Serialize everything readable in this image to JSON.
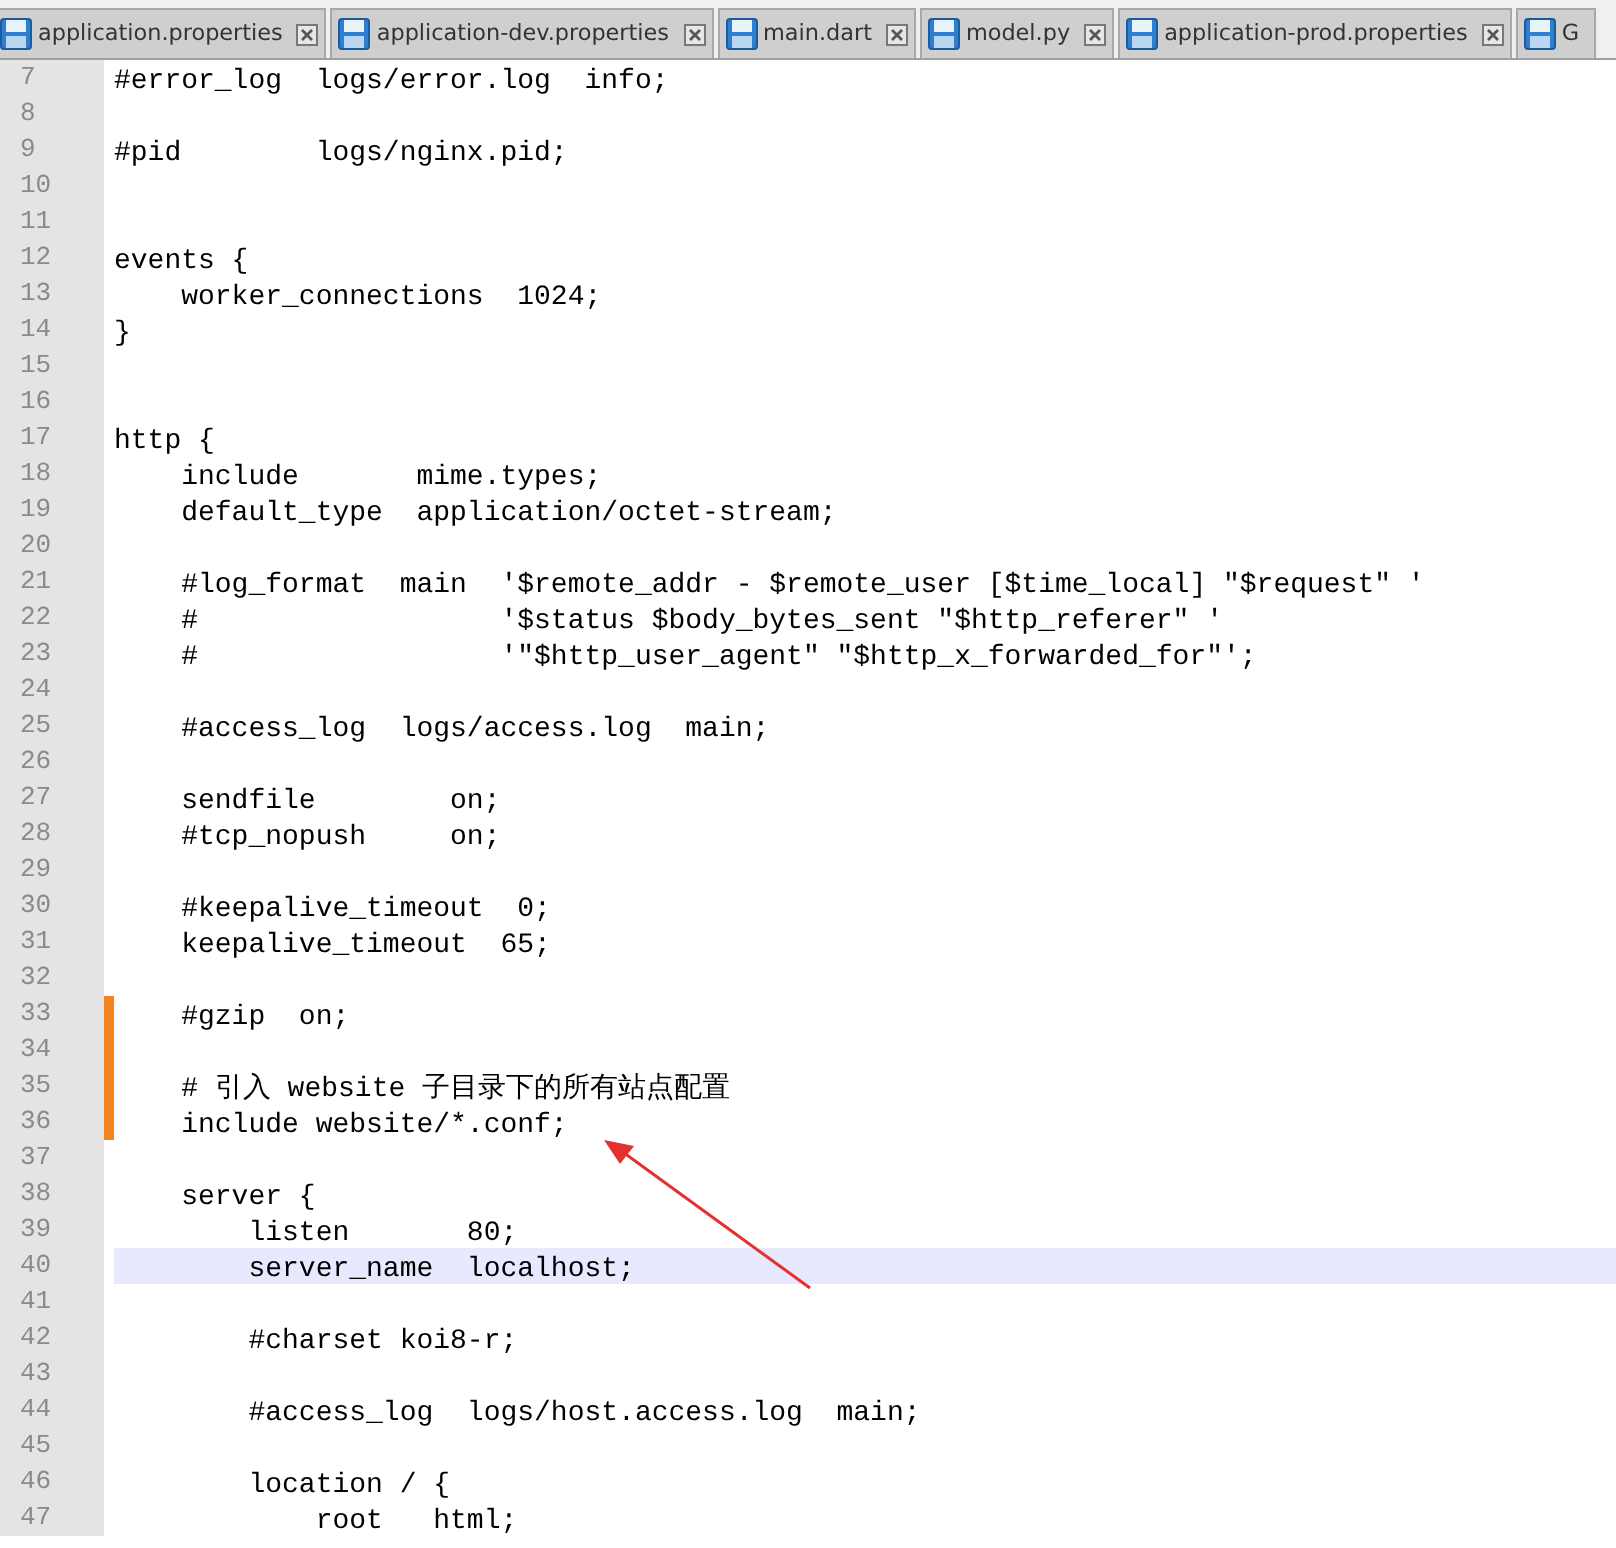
{
  "tabs": [
    {
      "label": "application.properties",
      "selected": false
    },
    {
      "label": "application-dev.properties",
      "selected": false
    },
    {
      "label": "main.dart",
      "selected": false
    },
    {
      "label": "model.py",
      "selected": false
    },
    {
      "label": "application-prod.properties",
      "selected": false
    },
    {
      "label": "G",
      "selected": false
    }
  ],
  "lines": [
    {
      "number": "7",
      "text": "#error_log  logs/error.log  info;",
      "modified": false,
      "current": false
    },
    {
      "number": "8",
      "modified": false,
      "current": false
    },
    {
      "number": "9",
      "text": "#pid        logs/nginx.pid;",
      "modified": false,
      "current": false
    },
    {
      "number": "10",
      "modified": false,
      "current": false
    },
    {
      "number": "11",
      "modified": false,
      "current": false
    },
    {
      "number": "12",
      "text": "events {",
      "modified": false,
      "current": false
    },
    {
      "number": "13",
      "text": "    worker_connections  1024;",
      "modified": false,
      "current": false
    },
    {
      "number": "14",
      "text": "}",
      "modified": false,
      "current": false
    },
    {
      "number": "15",
      "modified": false,
      "current": false
    },
    {
      "number": "16",
      "modified": false,
      "current": false
    },
    {
      "number": "17",
      "text": "http {",
      "modified": false,
      "current": false
    },
    {
      "number": "18",
      "text": "    include       mime.types;",
      "modified": false,
      "current": false
    },
    {
      "number": "19",
      "text": "    default_type  application/octet-stream;",
      "modified": false,
      "current": false
    },
    {
      "number": "20",
      "modified": false,
      "current": false
    },
    {
      "number": "21",
      "text": "    #log_format  main  '$remote_addr - $remote_user [$time_local] \"$request\" '",
      "modified": false,
      "current": false
    },
    {
      "number": "22",
      "text": "    #                  '$status $body_bytes_sent \"$http_referer\" '",
      "modified": false,
      "current": false
    },
    {
      "number": "23",
      "text": "    #                  '\"$http_user_agent\" \"$http_x_forwarded_for\"';",
      "modified": false,
      "current": false
    },
    {
      "number": "24",
      "modified": false,
      "current": false
    },
    {
      "number": "25",
      "text": "    #access_log  logs/access.log  main;",
      "modified": false,
      "current": false
    },
    {
      "number": "26",
      "modified": false,
      "current": false
    },
    {
      "number": "27",
      "text": "    sendfile        on;",
      "modified": false,
      "current": false
    },
    {
      "number": "28",
      "text": "    #tcp_nopush     on;",
      "modified": false,
      "current": false
    },
    {
      "number": "29",
      "modified": false,
      "current": false
    },
    {
      "number": "30",
      "text": "    #keepalive_timeout  0;",
      "modified": false,
      "current": false
    },
    {
      "number": "31",
      "text": "    keepalive_timeout  65;",
      "modified": false,
      "current": false
    },
    {
      "number": "32",
      "modified": false,
      "current": false
    },
    {
      "number": "33",
      "text": "    #gzip  on;",
      "modified": true,
      "current": false
    },
    {
      "number": "34",
      "modified": true,
      "current": false
    },
    {
      "number": "35",
      "text": "    # 引入 website 子目录下的所有站点配置",
      "modified": true,
      "current": false
    },
    {
      "number": "36",
      "text": "    include website/*.conf;",
      "modified": true,
      "current": false
    },
    {
      "number": "37",
      "modified": false,
      "current": false
    },
    {
      "number": "38",
      "text": "    server {",
      "modified": false,
      "current": false
    },
    {
      "number": "39",
      "text": "        listen       80;",
      "modified": false,
      "current": false
    },
    {
      "number": "40",
      "text": "        server_name  localhost;",
      "modified": false,
      "current": true
    },
    {
      "number": "41",
      "modified": false,
      "current": false
    },
    {
      "number": "42",
      "text": "        #charset koi8-r;",
      "modified": false,
      "current": false
    },
    {
      "number": "43",
      "modified": false,
      "current": false
    },
    {
      "number": "44",
      "text": "        #access_log  logs/host.access.log  main;",
      "modified": false,
      "current": false
    },
    {
      "number": "45",
      "modified": false,
      "current": false
    },
    {
      "number": "46",
      "text": "        location / {",
      "modified": false,
      "current": false
    },
    {
      "number": "47",
      "text": "            root   html;",
      "modified": false,
      "current": false
    }
  ]
}
